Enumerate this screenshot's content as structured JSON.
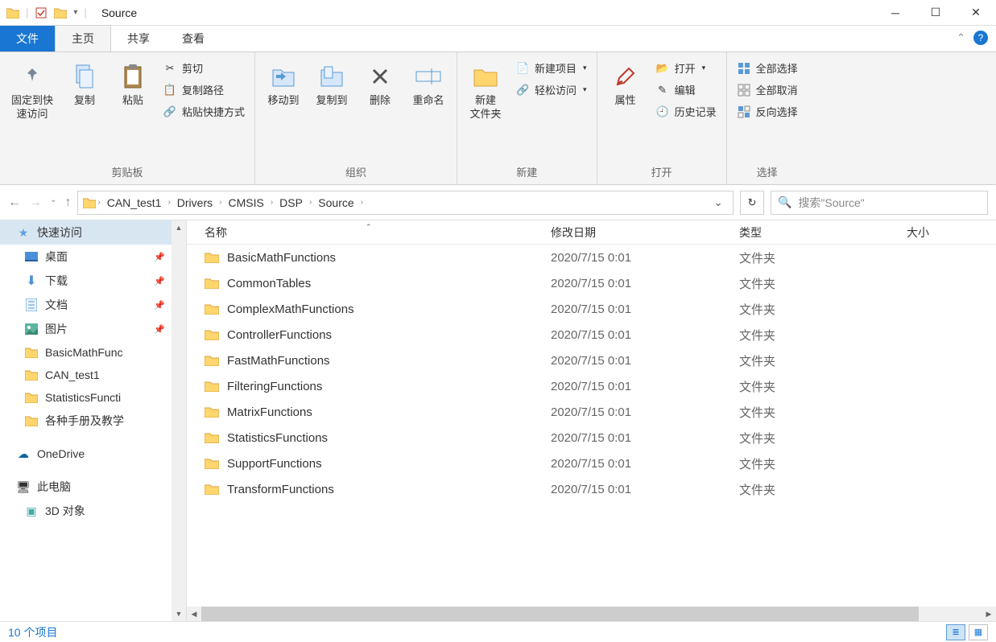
{
  "window": {
    "title": "Source"
  },
  "tabs": {
    "file": "文件",
    "home": "主页",
    "share": "共享",
    "view": "查看"
  },
  "ribbon": {
    "clipboard": {
      "label": "剪贴板",
      "pinQuick": "固定到快\n速访问",
      "copy": "复制",
      "paste": "粘贴",
      "cut": "剪切",
      "copyPath": "复制路径",
      "pasteShortcut": "粘贴快捷方式"
    },
    "organize": {
      "label": "组织",
      "moveTo": "移动到",
      "copyTo": "复制到",
      "delete": "删除",
      "rename": "重命名"
    },
    "new": {
      "label": "新建",
      "newFolder": "新建\n文件夹",
      "newItem": "新建项目",
      "easyAccess": "轻松访问"
    },
    "open": {
      "label": "打开",
      "properties": "属性",
      "open": "打开",
      "edit": "编辑",
      "history": "历史记录"
    },
    "select": {
      "label": "选择",
      "selectAll": "全部选择",
      "selectNone": "全部取消",
      "invert": "反向选择"
    }
  },
  "breadcrumb": {
    "items": [
      "CAN_test1",
      "Drivers",
      "CMSIS",
      "DSP",
      "Source"
    ]
  },
  "search": {
    "placeholder": "搜索\"Source\""
  },
  "sidebar": {
    "quickAccess": "快速访问",
    "items": [
      {
        "label": "桌面",
        "pinned": true,
        "icon": "desktop"
      },
      {
        "label": "下载",
        "pinned": true,
        "icon": "download"
      },
      {
        "label": "文档",
        "pinned": true,
        "icon": "document"
      },
      {
        "label": "图片",
        "pinned": true,
        "icon": "picture"
      },
      {
        "label": "BasicMathFunc",
        "pinned": false,
        "icon": "folder"
      },
      {
        "label": "CAN_test1",
        "pinned": false,
        "icon": "folder"
      },
      {
        "label": "StatisticsFuncti",
        "pinned": false,
        "icon": "folder"
      },
      {
        "label": "各种手册及教学",
        "pinned": false,
        "icon": "folder"
      }
    ],
    "oneDrive": "OneDrive",
    "thisPC": "此电脑",
    "objects3d": "3D 对象"
  },
  "columns": {
    "name": "名称",
    "date": "修改日期",
    "type": "类型",
    "size": "大小"
  },
  "files": [
    {
      "name": "BasicMathFunctions",
      "date": "2020/7/15 0:01",
      "type": "文件夹"
    },
    {
      "name": "CommonTables",
      "date": "2020/7/15 0:01",
      "type": "文件夹"
    },
    {
      "name": "ComplexMathFunctions",
      "date": "2020/7/15 0:01",
      "type": "文件夹"
    },
    {
      "name": "ControllerFunctions",
      "date": "2020/7/15 0:01",
      "type": "文件夹"
    },
    {
      "name": "FastMathFunctions",
      "date": "2020/7/15 0:01",
      "type": "文件夹"
    },
    {
      "name": "FilteringFunctions",
      "date": "2020/7/15 0:01",
      "type": "文件夹"
    },
    {
      "name": "MatrixFunctions",
      "date": "2020/7/15 0:01",
      "type": "文件夹"
    },
    {
      "name": "StatisticsFunctions",
      "date": "2020/7/15 0:01",
      "type": "文件夹"
    },
    {
      "name": "SupportFunctions",
      "date": "2020/7/15 0:01",
      "type": "文件夹"
    },
    {
      "name": "TransformFunctions",
      "date": "2020/7/15 0:01",
      "type": "文件夹"
    }
  ],
  "status": {
    "count": "10 个项目"
  }
}
